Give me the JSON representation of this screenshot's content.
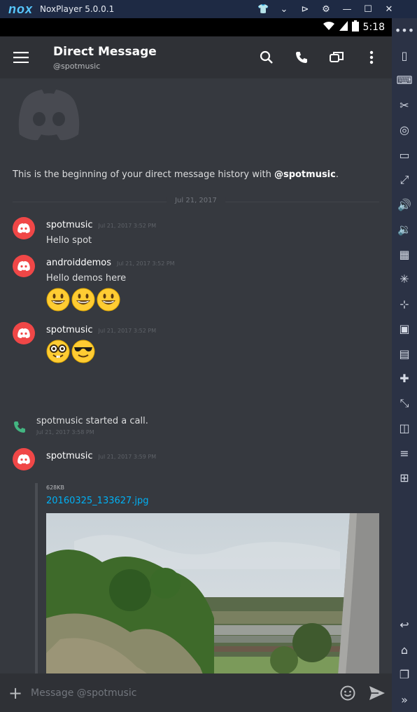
{
  "window": {
    "logo": "nox",
    "title": "NoxPlayer 5.0.0.1"
  },
  "statusbar": {
    "time": "5:18"
  },
  "appbar": {
    "title": "Direct Message",
    "subtitle": "@spotmusic"
  },
  "welcome": {
    "prefix": "This is the beginning of your direct message history with ",
    "user": "@spotmusic",
    "suffix": "."
  },
  "divider_date": "Jul 21, 2017",
  "messages": [
    {
      "user": "spotmusic",
      "time": "Jul 21, 2017 3:52 PM",
      "text": "Hello spot"
    },
    {
      "user": "androiddemos",
      "time": "Jul 21, 2017 3:52 PM",
      "text": "Hello demos here",
      "emojis": [
        "grinning",
        "grinning",
        "grinning"
      ]
    },
    {
      "user": "spotmusic",
      "time": "Jul 21, 2017 3:52 PM",
      "emojis": [
        "nerd",
        "sunglasses"
      ]
    },
    {
      "user": "spotmusic",
      "time": "Jul 21, 2017 3:59 PM"
    }
  ],
  "call_event": {
    "text": "spotmusic started a call.",
    "time": "Jul 21, 2017 3:58 PM"
  },
  "attachment": {
    "size": "628KB",
    "filename": "20160325_133627.jpg"
  },
  "composer": {
    "placeholder": "Message @spotmusic"
  },
  "colors": {
    "accent": "#00b0f4",
    "avatar": "#f04747",
    "call": "#43b581",
    "background": "#36393f"
  },
  "icons": {
    "titlebar": [
      "shirt-icon",
      "chevron-down-icon",
      "pin-icon",
      "gear-icon",
      "minimize-icon",
      "maximize-icon",
      "close-icon"
    ],
    "sidebar": [
      "more-icon",
      "shake-icon",
      "keyboard-icon",
      "scissors-icon",
      "location-icon",
      "screen-icon",
      "fullscreen-icon",
      "volume-up-icon",
      "volume-down-icon",
      "apk-icon",
      "loading-icon",
      "virtual-mouse-icon",
      "video-record-icon",
      "multi-instance-icon",
      "controller-icon",
      "resize-icon",
      "app-list-icon",
      "menu-icon",
      "add-icon",
      "back-icon",
      "home-icon",
      "recent-apps-icon",
      "expand-icon"
    ]
  }
}
